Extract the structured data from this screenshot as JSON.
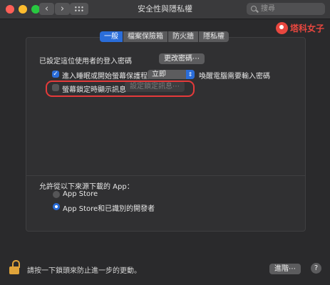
{
  "window": {
    "title": "安全性與隱私權",
    "search_placeholder": "搜尋",
    "back_glyph": "‹",
    "forward_glyph": "›"
  },
  "watermark": {
    "text": "塔科女子"
  },
  "tabs": [
    {
      "label": "一般",
      "active": true
    },
    {
      "label": "檔案保險箱",
      "active": false
    },
    {
      "label": "防火牆",
      "active": false
    },
    {
      "label": "隱私權",
      "active": false
    }
  ],
  "general": {
    "password_set_label": "已設定這位使用者的登入密碼",
    "change_password_button": "更改密碼⋯",
    "require_password": {
      "checked": true,
      "label": "進入睡眠或開始螢幕保護程式",
      "select_value": "立即",
      "suffix": "喚醒電腦需要輸入密碼"
    },
    "lock_message": {
      "checked": false,
      "label": "螢幕鎖定時顯示訊息",
      "button": "設定鎖定訊息⋯"
    }
  },
  "allow_apps": {
    "heading": "允許從以下來源下載的 App：",
    "options": [
      {
        "label": "App Store",
        "selected": false
      },
      {
        "label": "App Store和已識別的開發者",
        "selected": true
      }
    ]
  },
  "footer": {
    "lock_text": "請按一下鎖頭來防止進一步的更動。",
    "advanced_button": "進階⋯",
    "help": "?"
  },
  "colors": {
    "accent": "#2a6dd9",
    "highlight": "#e53a3a",
    "watermark": "#e8473f",
    "lock": "#e0a43a"
  }
}
